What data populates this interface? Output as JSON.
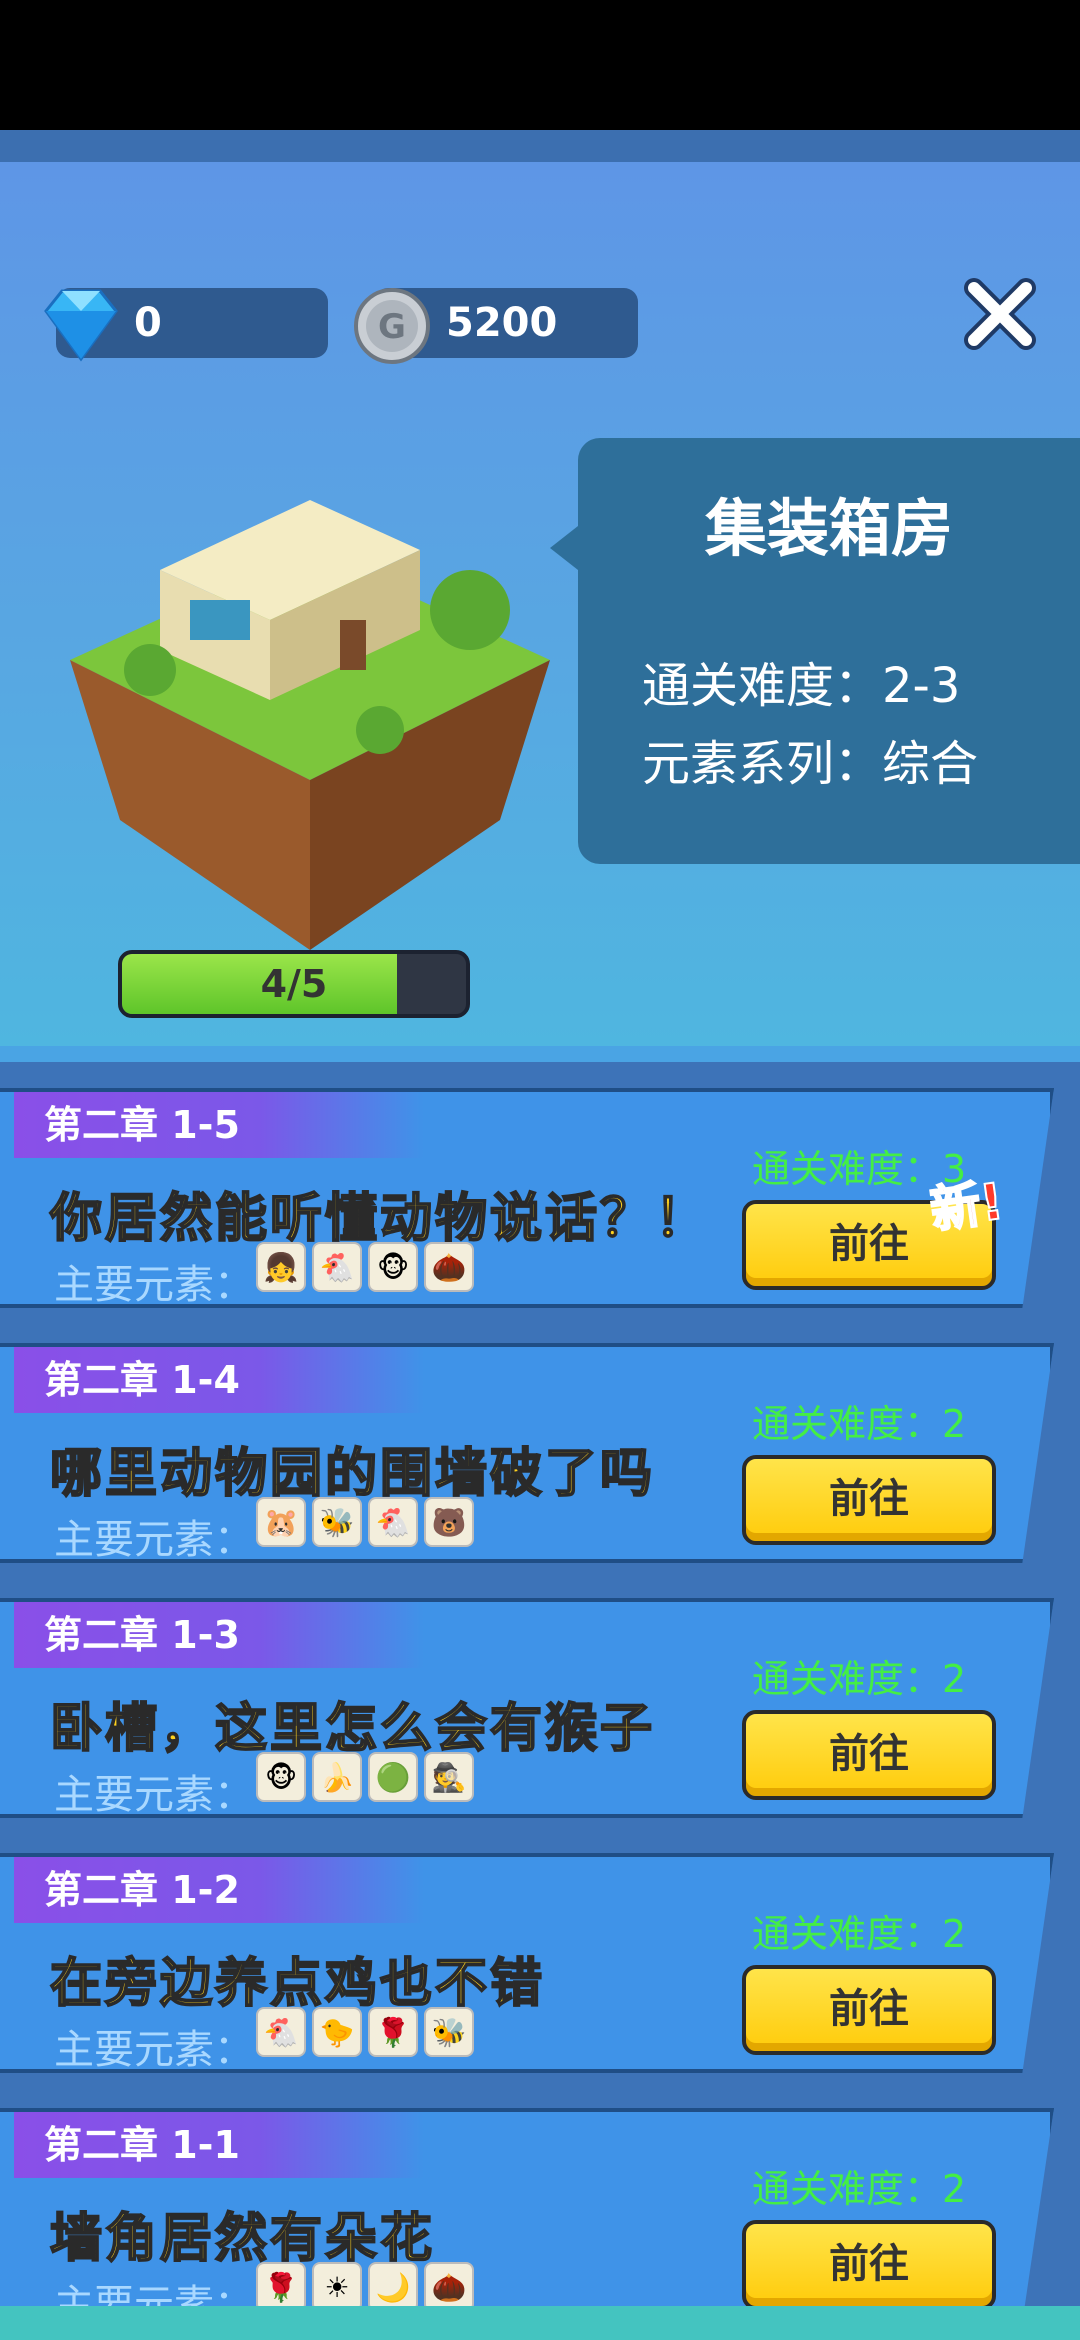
{
  "currency": {
    "gems": "0",
    "coins": "5200",
    "coin_icon": "coin-icon",
    "gem_icon": "diamond-icon"
  },
  "building": {
    "name": "集装箱房",
    "difficulty_line": "通关难度：2-3",
    "series_line": "元素系列：综合",
    "progress_text": "4/5",
    "progress_fraction": 0.8
  },
  "chapters": [
    {
      "tag": "第二章 1-5",
      "title": "你居然能听懂动物说话？！",
      "elements_label": "主要元素：",
      "difficulty": "通关难度：3",
      "button": "前往",
      "new_badge": "新!",
      "elements": [
        "girl-icon",
        "chicken-icon",
        "monkey-icon",
        "seed-icon"
      ]
    },
    {
      "tag": "第二章 1-4",
      "title": "哪里动物园的围墙破了吗",
      "elements_label": "主要元素：",
      "difficulty": "通关难度：2",
      "button": "前往",
      "elements": [
        "hamster-icon",
        "bee-icon",
        "chicken-icon",
        "bear-icon"
      ]
    },
    {
      "tag": "第二章 1-3",
      "title": "卧槽，这里怎么会有猴子",
      "elements_label": "主要元素：",
      "difficulty": "通关难度：2",
      "button": "前往",
      "elements": [
        "monkey-icon",
        "banana-icon",
        "durian-icon",
        "thief-icon"
      ]
    },
    {
      "tag": "第二章 1-2",
      "title": "在旁边养点鸡也不错",
      "elements_label": "主要元素：",
      "difficulty": "通关难度：2",
      "button": "前往",
      "elements": [
        "chicken-icon",
        "chick-icon",
        "rose-icon",
        "bee-icon"
      ]
    },
    {
      "tag": "第二章 1-1",
      "title": "墙角居然有朵花",
      "elements_label": "主要元素：",
      "difficulty": "通关难度：2",
      "button": "前往",
      "elements": [
        "rose-icon",
        "sun-icon",
        "moon-icon",
        "seed-icon"
      ]
    }
  ]
}
